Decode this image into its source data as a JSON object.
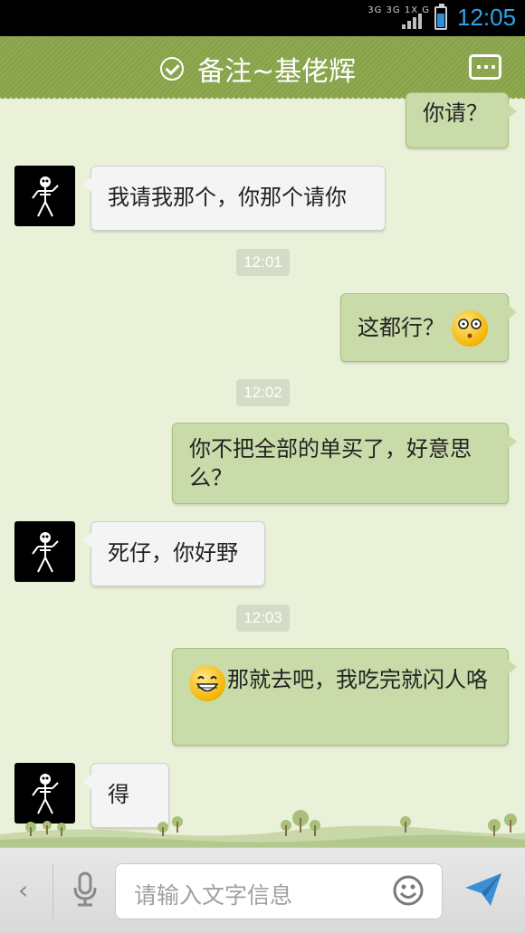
{
  "status_bar": {
    "network": "3G 3G 1X G",
    "time": "12:05",
    "battery_level": 0.7,
    "battery_color": "#2c8fd8",
    "time_color": "#2fa4e7"
  },
  "header": {
    "title": "备注~基佬辉",
    "verified_icon": "check-circle-icon",
    "more_icon": "more-dots-icon",
    "background": "#8aa64a"
  },
  "messages": [
    {
      "side": "out",
      "text": "你请？"
    },
    {
      "side": "in",
      "text": "我请我那个，你那个请你"
    },
    {
      "type": "time",
      "text": "12:01"
    },
    {
      "side": "out",
      "text": "这都行？",
      "emoji": "dizzy-face-emoji"
    },
    {
      "type": "time",
      "text": "12:02"
    },
    {
      "side": "out",
      "text": "你不把全部的单买了，好意思么？"
    },
    {
      "side": "in",
      "text": "死仔，你好野"
    },
    {
      "type": "time",
      "text": "12:03"
    },
    {
      "side": "out",
      "text": "那就去吧，我吃完就闪人咯",
      "emoji": "grin-face-emoji"
    },
    {
      "side": "in",
      "text": "得"
    }
  ],
  "input_bar": {
    "placeholder": "请输入文字信息",
    "back_icon": "chevron-left-icon",
    "voice_icon": "microphone-icon",
    "emoji_icon": "smiley-icon",
    "send_icon": "send-icon"
  }
}
